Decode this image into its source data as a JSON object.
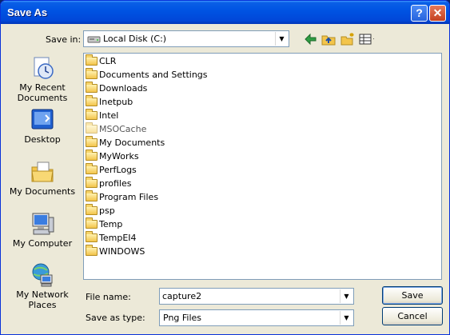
{
  "window": {
    "title": "Save As",
    "help_label": "?",
    "close_label": "✕"
  },
  "save_in": {
    "label": "Save in:",
    "value": "Local Disk (C:)"
  },
  "places": [
    {
      "label": "My Recent Documents",
      "icon": "recent-documents-icon"
    },
    {
      "label": "Desktop",
      "icon": "desktop-icon"
    },
    {
      "label": "My Documents",
      "icon": "my-documents-icon"
    },
    {
      "label": "My Computer",
      "icon": "my-computer-icon"
    },
    {
      "label": "My Network Places",
      "icon": "network-places-icon"
    }
  ],
  "files": [
    {
      "name": "CLR",
      "dim": false
    },
    {
      "name": "Documents and Settings",
      "dim": false
    },
    {
      "name": "Downloads",
      "dim": false
    },
    {
      "name": "Inetpub",
      "dim": false
    },
    {
      "name": "Intel",
      "dim": false
    },
    {
      "name": "MSOCache",
      "dim": true
    },
    {
      "name": "My Documents",
      "dim": false
    },
    {
      "name": "MyWorks",
      "dim": false
    },
    {
      "name": "PerfLogs",
      "dim": false
    },
    {
      "name": "profiles",
      "dim": false
    },
    {
      "name": "Program Files",
      "dim": false
    },
    {
      "name": "psp",
      "dim": false
    },
    {
      "name": "Temp",
      "dim": false
    },
    {
      "name": "TempEI4",
      "dim": false
    },
    {
      "name": "WINDOWS",
      "dim": false
    }
  ],
  "file_name": {
    "label": "File name:",
    "value": "capture2"
  },
  "save_as_type": {
    "label": "Save as type:",
    "value": "Png Files"
  },
  "buttons": {
    "save": "Save",
    "cancel": "Cancel"
  },
  "colors": {
    "titlebar": "#0054e3",
    "dialog_bg": "#ece9d8",
    "field_border": "#7f9db9"
  }
}
